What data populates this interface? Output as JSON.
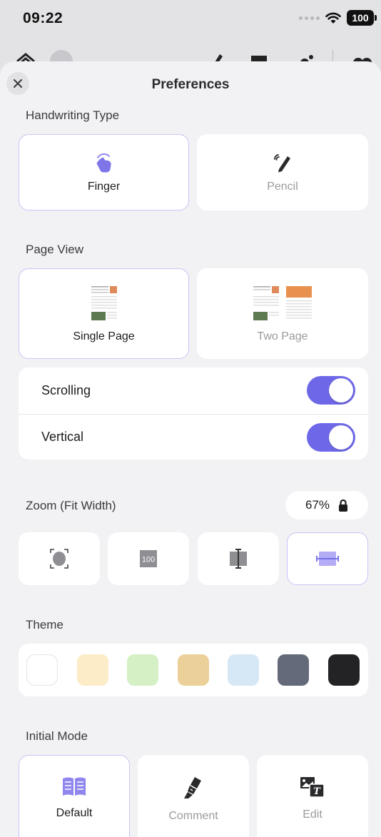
{
  "status": {
    "time": "09:22",
    "battery": "100"
  },
  "sheet": {
    "title": "Preferences"
  },
  "handwriting": {
    "label": "Handwriting Type",
    "options": [
      {
        "label": "Finger",
        "selected": true
      },
      {
        "label": "Pencil",
        "selected": false
      }
    ]
  },
  "page_view": {
    "label": "Page View",
    "options": [
      {
        "label": "Single Page",
        "selected": true
      },
      {
        "label": "Two Page",
        "selected": false
      }
    ],
    "toggles": [
      {
        "label": "Scrolling",
        "on": true
      },
      {
        "label": "Vertical",
        "on": true
      }
    ]
  },
  "zoom": {
    "label": "Zoom (Fit Width)",
    "value": "67%",
    "modes": [
      "fit-page-icon",
      "actual-size-icon",
      "fit-height-icon",
      "fit-width-icon"
    ],
    "selected": "fit-width-icon"
  },
  "theme": {
    "label": "Theme",
    "swatches": [
      "#ffffff",
      "#fcecc8",
      "#d4f0c4",
      "#ecd09a",
      "#d6e8f6",
      "#646a7a",
      "#232326"
    ]
  },
  "initial_mode": {
    "label": "Initial Mode",
    "options": [
      {
        "label": "Default",
        "selected": true
      },
      {
        "label": "Comment",
        "selected": false
      },
      {
        "label": "Edit",
        "selected": false
      }
    ]
  },
  "colors": {
    "accent": "#6e68e8",
    "accent_light": "#c7c5f5",
    "icon_purple": "#8f86ee"
  }
}
